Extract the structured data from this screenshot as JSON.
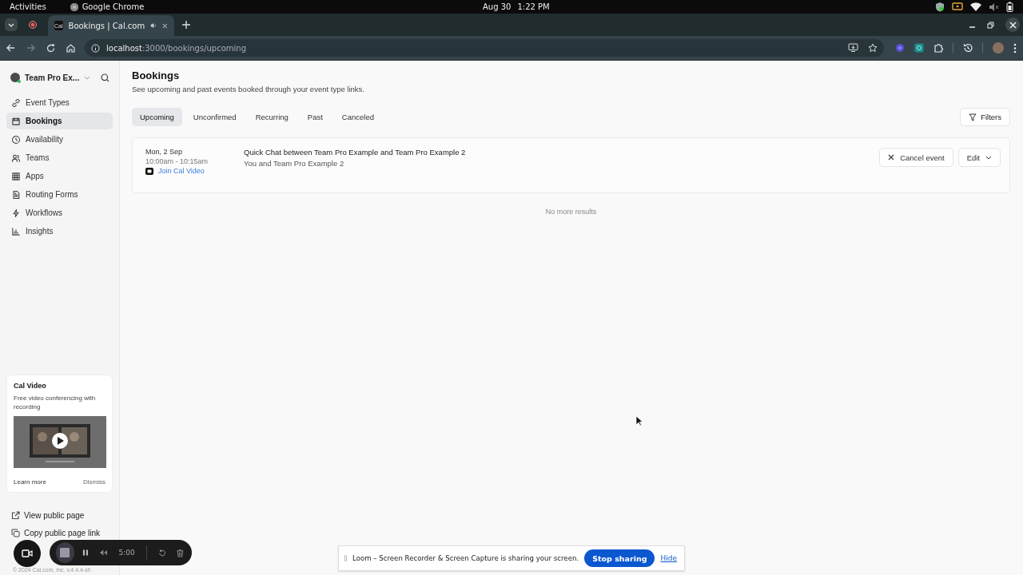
{
  "system_bar": {
    "activities": "Activities",
    "app": "Google Chrome",
    "date": "Aug 30",
    "time": "1:22 PM"
  },
  "browser": {
    "tab_title": "Bookings | Cal.com",
    "favicon": "Cal",
    "url_host": "localhost",
    "url_path": ":3000/bookings/upcoming"
  },
  "sidebar": {
    "team": "Team Pro Ex...",
    "items": [
      {
        "label": "Event Types",
        "selected": false
      },
      {
        "label": "Bookings",
        "selected": true
      },
      {
        "label": "Availability",
        "selected": false
      },
      {
        "label": "Teams",
        "selected": false
      },
      {
        "label": "Apps",
        "selected": false
      },
      {
        "label": "Routing Forms",
        "selected": false
      },
      {
        "label": "Workflows",
        "selected": false
      },
      {
        "label": "Insights",
        "selected": false
      }
    ],
    "promo": {
      "title": "Cal Video",
      "description": "Free video conferencing with recording",
      "learn_more": "Learn more",
      "dismiss": "Dismiss"
    },
    "links": [
      "View public page",
      "Copy public page link"
    ],
    "footer": "© 2024 Cal.com, Inc. v.4.4.4-sh"
  },
  "main": {
    "title": "Bookings",
    "subtitle": "See upcoming and past events booked through your event type links.",
    "tabs": [
      {
        "label": "Upcoming",
        "selected": true
      },
      {
        "label": "Unconfirmed",
        "selected": false
      },
      {
        "label": "Recurring",
        "selected": false
      },
      {
        "label": "Past",
        "selected": false
      },
      {
        "label": "Canceled",
        "selected": false
      }
    ],
    "filters": "Filters",
    "bookings": [
      {
        "date": "Mon, 2 Sep",
        "time": "10:00am - 10:15am",
        "join": "Join Cal Video",
        "title": "Quick Chat between Team Pro Example and Team Pro Example 2",
        "attendees": "You and Team Pro Example 2",
        "cancel": "Cancel event",
        "edit": "Edit"
      }
    ],
    "end_message": "No more results"
  },
  "recorder": {
    "timer": "5:00"
  },
  "loom": {
    "message": "Loom – Screen Recorder & Screen Capture is sharing your screen.",
    "stop": "Stop sharing",
    "hide": "Hide"
  }
}
